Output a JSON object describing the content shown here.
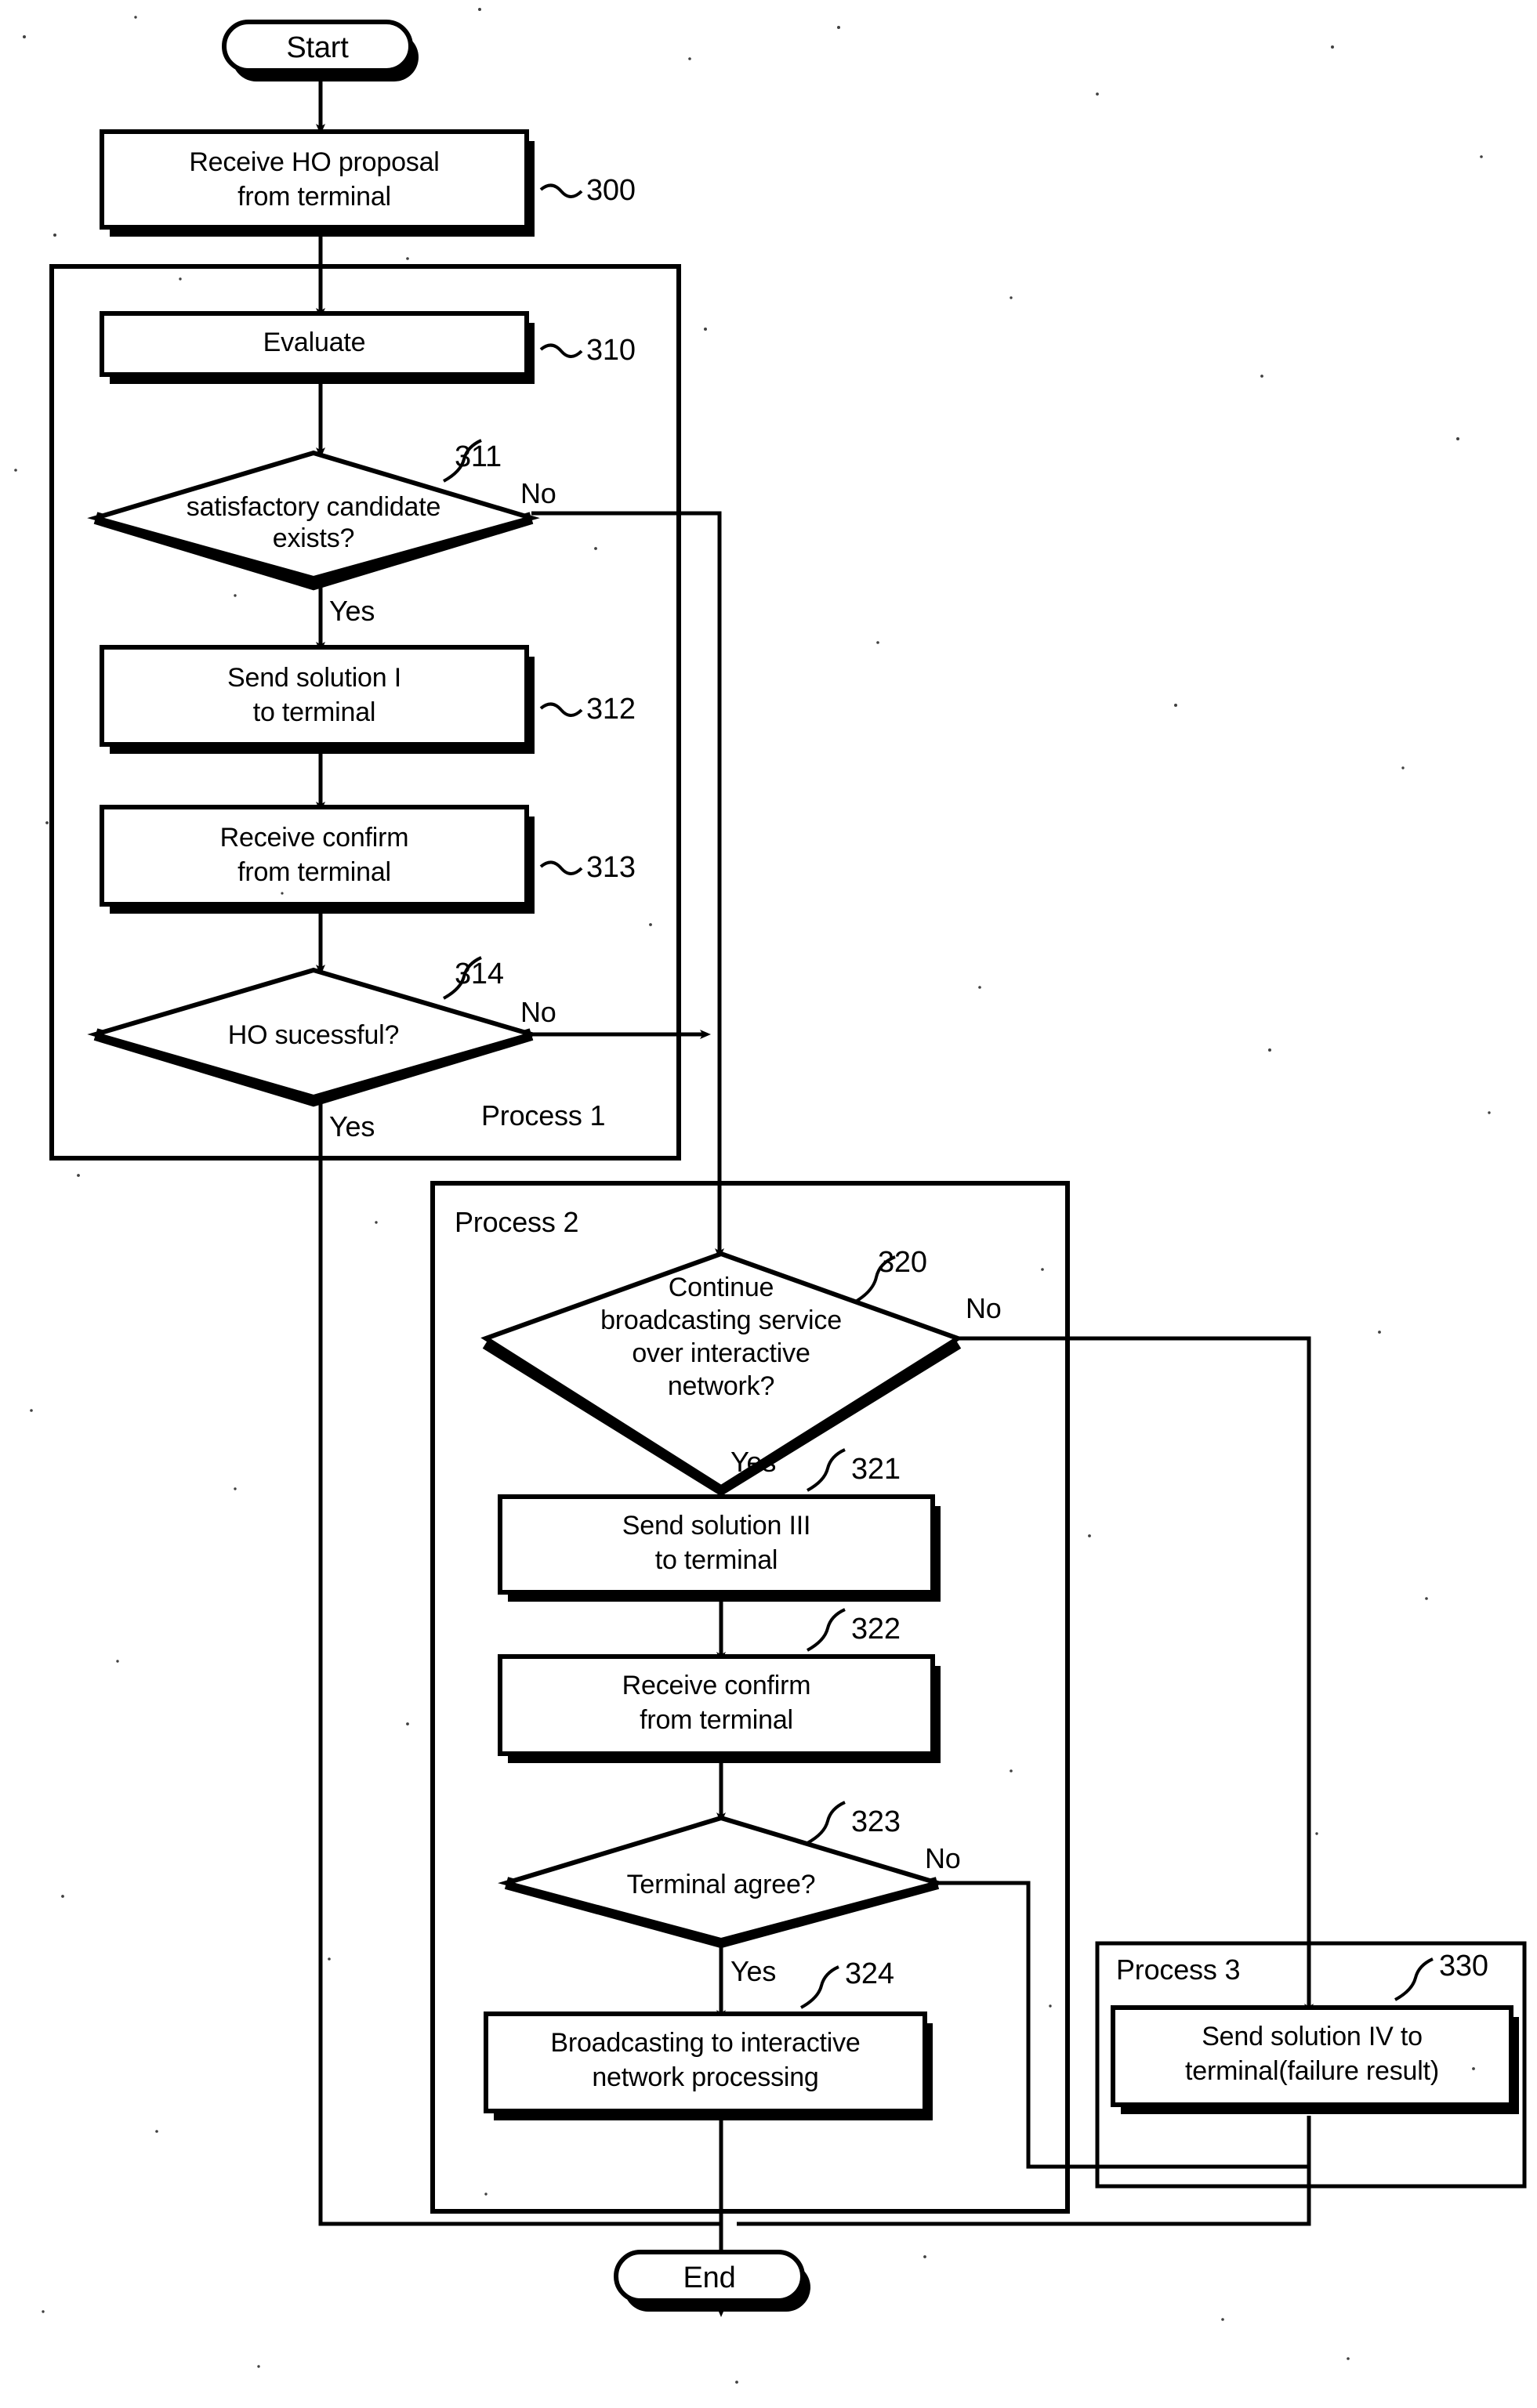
{
  "diagram": {
    "type": "flowchart",
    "title": "",
    "terminals": {
      "start": "Start",
      "end": "End"
    },
    "groups": [
      {
        "id": "process1",
        "label": "Process 1"
      },
      {
        "id": "process2",
        "label": "Process 2"
      },
      {
        "id": "process3",
        "label": "Process 3"
      }
    ],
    "nodes": [
      {
        "id": "n300",
        "ref": "300",
        "shape": "process",
        "lines": [
          "Receive HO proposal",
          "from terminal"
        ]
      },
      {
        "id": "n310",
        "ref": "310",
        "shape": "process",
        "lines": [
          "Evaluate"
        ]
      },
      {
        "id": "n311",
        "ref": "311",
        "shape": "decision",
        "lines": [
          "satisfactory candidate",
          "exists?"
        ]
      },
      {
        "id": "n312",
        "ref": "312",
        "shape": "process",
        "lines": [
          "Send solution I",
          "to terminal"
        ]
      },
      {
        "id": "n313",
        "ref": "313",
        "shape": "process",
        "lines": [
          "Receive confirm",
          "from terminal"
        ]
      },
      {
        "id": "n314",
        "ref": "314",
        "shape": "decision",
        "lines": [
          "HO sucessful?"
        ]
      },
      {
        "id": "n320",
        "ref": "320",
        "shape": "decision",
        "lines": [
          "Continue",
          "broadcasting service",
          "over interactive",
          "network?"
        ]
      },
      {
        "id": "n321",
        "ref": "321",
        "shape": "process",
        "lines": [
          "Send solution III",
          "to terminal"
        ]
      },
      {
        "id": "n322",
        "ref": "322",
        "shape": "process",
        "lines": [
          "Receive confirm",
          "from terminal"
        ]
      },
      {
        "id": "n323",
        "ref": "323",
        "shape": "decision",
        "lines": [
          "Terminal agree?"
        ]
      },
      {
        "id": "n324",
        "ref": "324",
        "shape": "process",
        "lines": [
          "Broadcasting to interactive",
          "network processing"
        ]
      },
      {
        "id": "n330",
        "ref": "330",
        "shape": "process",
        "lines": [
          "Send solution IV to",
          "terminal(failure result)"
        ]
      }
    ],
    "branch_labels": {
      "n311_no": "No",
      "n311_yes": "Yes",
      "n314_no": "No",
      "n314_yes": "Yes",
      "n320_no": "No",
      "n320_yes": "Yes",
      "n323_no": "No",
      "n323_yes": "Yes"
    },
    "colors": {
      "stroke": "#000000",
      "fill": "#ffffff",
      "shadow": "#000000",
      "background": "#ffffff"
    }
  }
}
